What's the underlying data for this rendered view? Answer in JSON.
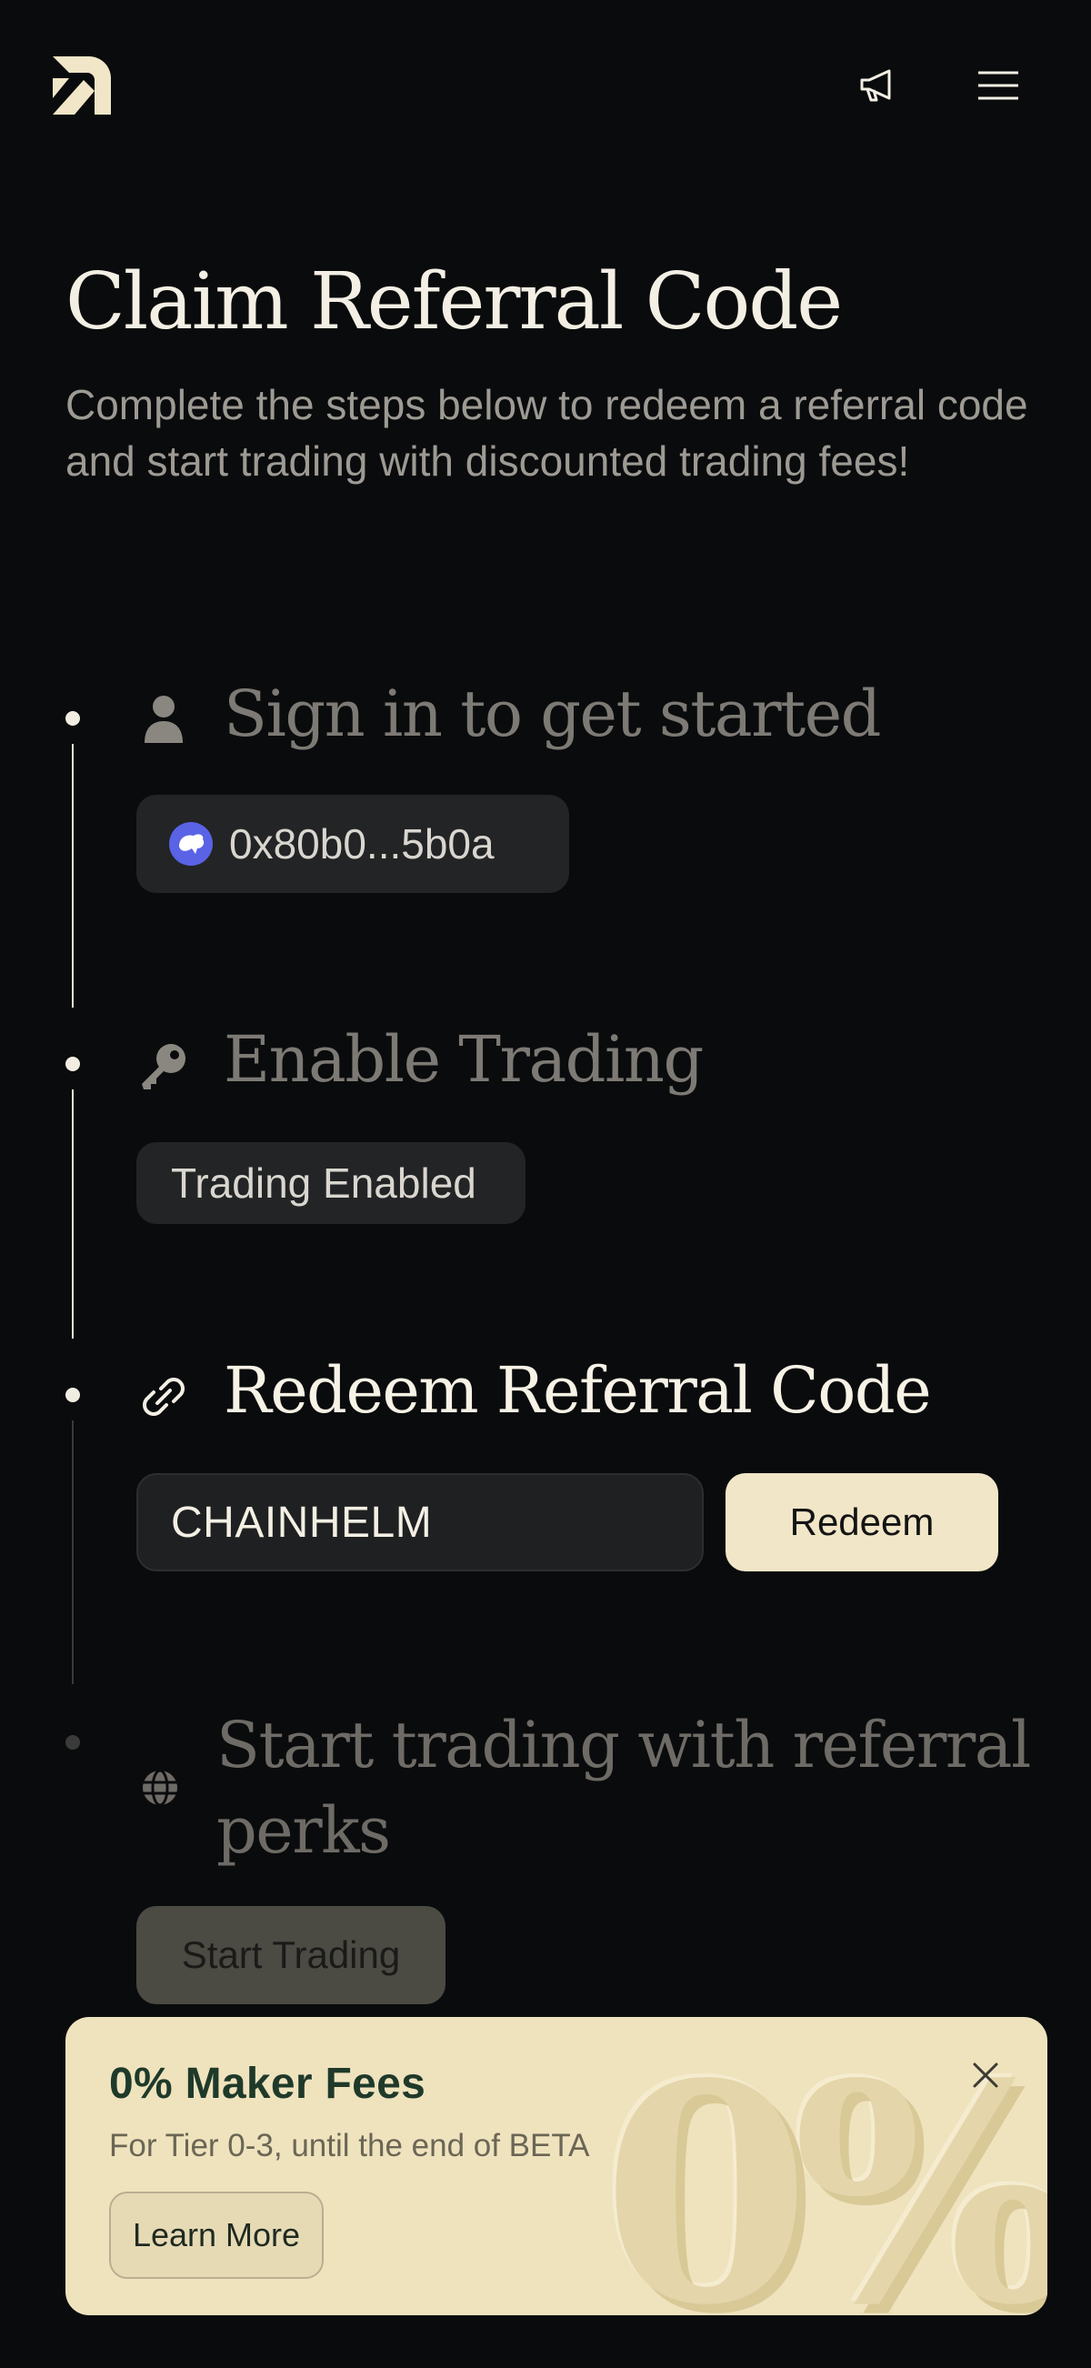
{
  "header": {
    "logo_icon": "app-logo-icon",
    "announcement_icon": "megaphone-icon",
    "menu_icon": "hamburger-menu-icon"
  },
  "page": {
    "title": "Claim Referral Code",
    "subtitle": "Complete the steps below to redeem a referral code and start trading with discounted trading fees!"
  },
  "steps": [
    {
      "title": "Sign in to get started",
      "icon": "user-icon",
      "state": "completed",
      "wallet_address": "0x80b0...5b0a"
    },
    {
      "title": "Enable Trading",
      "icon": "key-icon",
      "state": "completed",
      "status_label": "Trading Enabled"
    },
    {
      "title": "Redeem Referral Code",
      "icon": "link-icon",
      "state": "active",
      "input_value": "CHAINHELM",
      "button_label": "Redeem"
    },
    {
      "title": "Start trading with referral perks",
      "icon": "globe-icon",
      "state": "pending",
      "button_label": "Start Trading"
    }
  ],
  "promo": {
    "title": "0% Maker Fees",
    "subtitle": "For Tier 0-3, until the end of BETA",
    "button_label": "Learn More",
    "graphic_text": "0%",
    "close_icon": "close-icon"
  },
  "colors": {
    "background": "#0a0b0c",
    "accent_cream": "#f1e6c7",
    "promo_title": "#1f3a2a",
    "wallet_avatar": "#5a62e6"
  }
}
